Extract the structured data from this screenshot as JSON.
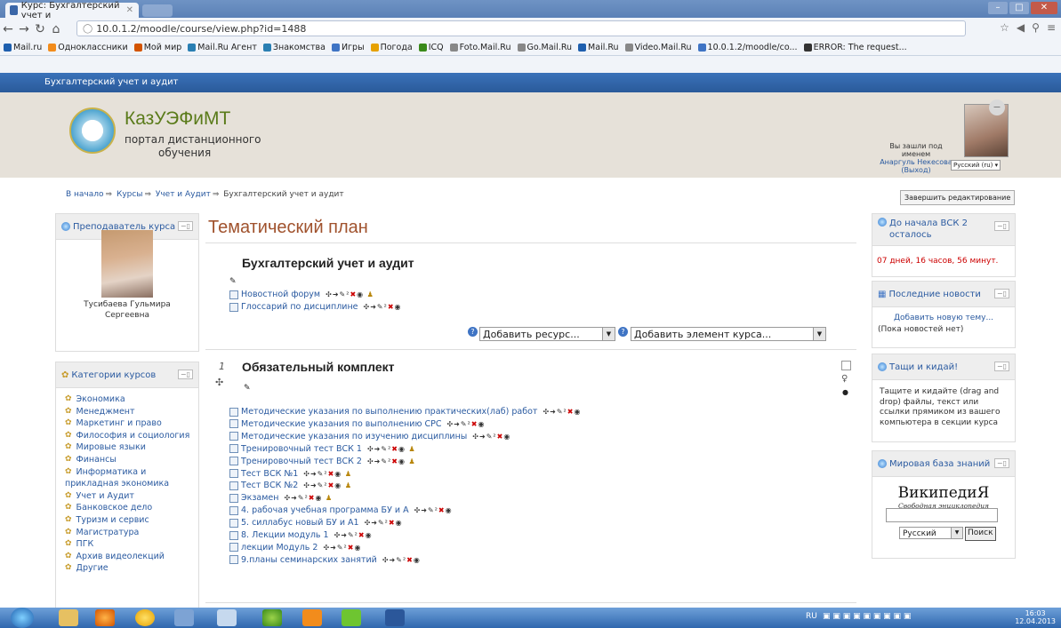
{
  "browser": {
    "tab_title": "Курс: Бухгалтерский учет и",
    "url": "10.0.1.2/moodle/course/view.php?id=1488",
    "bookmarks": [
      "Mail.ru",
      "Одноклассники",
      "Мой мир",
      "Mail.Ru Агент",
      "Знакомства",
      "Игры",
      "Погода",
      "ICQ",
      "Foto.Mail.Ru",
      "Go.Mail.Ru",
      "Mail.Ru",
      "Video.Mail.Ru",
      "10.0.1.2/moodle/co...",
      "ERROR: The request..."
    ]
  },
  "navbar": {
    "course_name": "Бухгалтерский учет и аудит"
  },
  "header": {
    "logo_title": "КазУЭФиМТ",
    "logo_sub1": "портал дистанционного",
    "logo_sub2": "обучения",
    "login_label": "Вы зашли под именем",
    "user_name": "Анаргуль Некесова",
    "logout": "(Выход)",
    "language": "Русский (ru)"
  },
  "breadcrumb": [
    "В начало",
    "Курсы",
    "Учет и Аудит",
    "Бухгалтерский учет и аудит"
  ],
  "finish_editing": "Завершить редактирование",
  "left": {
    "teacher_block_title": "Преподаватель курса",
    "teacher_name_1": "Тусибаева Гульмира",
    "teacher_name_2": "Сергеевна",
    "categories_title": "Категории курсов",
    "categories": [
      "Экономика",
      "Менеджмент",
      "Маркетинг и право",
      "Философия и социология",
      "Мировые языки",
      "Финансы",
      "Информатика и",
      "прикладная экономика",
      "Учет и Аудит",
      "Банковское дело",
      "Туризм и сервис",
      "Магистратура",
      "ПГК",
      "Архив видеолекций",
      "Другие"
    ]
  },
  "main": {
    "title": "Тематический план",
    "section0_title": "Бухгалтерский учет и аудит",
    "section0_items": [
      "Новостной форум",
      "Глоссарий по дисциплине"
    ],
    "add_resource": "Добавить ресурс...",
    "add_element": "Добавить элемент курса...",
    "section1_number": "1",
    "section1_title": "Обязательный комплект",
    "section1_items": [
      "Методические указания по выполнению практических(лаб) работ",
      "Методические указания по выполнению СРС",
      "Методические указания по изучению дисциплины",
      "Тренировочный тест ВСК 1",
      "Тренировочный тест ВСК 2",
      "Тест ВСК №1",
      "Тест ВСК №2",
      "Экзамен",
      "4. рабочая учебная программа БУ и А",
      "5. силлабус новый БУ и А1",
      "8. Лекции модуль 1",
      "лекции Модуль 2",
      "9.планы семинарских занятий"
    ]
  },
  "right": {
    "countdown_title": "До начала ВСК 2 осталось",
    "countdown_value": "07 дней, 16 часов, 56 минут.",
    "news_title": "Последние новости",
    "news_add": "Добавить новую тему...",
    "news_empty": "(Пока новостей нет)",
    "drag_title": "Тащи и кидай!",
    "drag_text": "Тащите и кидайте (drag and drop) файлы, текст или ссылки прямиком из вашего компьютера в секции курса",
    "wiki_title": "Мировая база знаний",
    "wiki_logo": "ВикипедиЯ",
    "wiki_sub": "Свободная энциклопедия",
    "wiki_lang": "Русский",
    "wiki_search": "Поиск"
  },
  "taskbar": {
    "lang": "RU",
    "time": "16:03",
    "date": "12.04.2013"
  }
}
